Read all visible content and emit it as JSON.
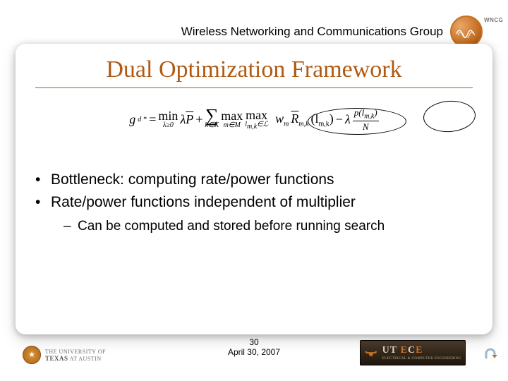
{
  "header": {
    "group_name": "Wireless Networking and Communications Group",
    "logo_label": "WNCG"
  },
  "title": "Dual Optimization Framework",
  "formula": {
    "lhs": "g*_d",
    "eq": "=",
    "min_op": "min",
    "min_sub": "λ≥0",
    "lambda_p": "λP̄",
    "plus": "+",
    "sum_sub": "k∈K",
    "max1_op": "max",
    "max1_sub": "m∈M",
    "max2_op": "max",
    "max2_sub": "l_{m,k}∈L",
    "w": "w_m",
    "R": "R̄_{m,k}",
    "Rarg": "(l_{m,k})",
    "minus": "−",
    "lambda2": "λ",
    "p_frac_top": "p(l_{m,k})",
    "p_frac_bot": "N"
  },
  "bullets": {
    "b1a": "Bottleneck: computing rate/power functions",
    "b1b": "Rate/power functions independent of multiplier",
    "b2a": "Can be computed and stored before running search"
  },
  "footer": {
    "page_no": "30",
    "date": "April 30, 2007",
    "ut_line1": "THE UNIVERSITY OF",
    "ut_line2": "TEXAS",
    "ut_line3": "AT AUSTIN",
    "utece_main": "UT ECE",
    "utece_sub": "ELECTRICAL & COMPUTER ENGINEERING"
  }
}
